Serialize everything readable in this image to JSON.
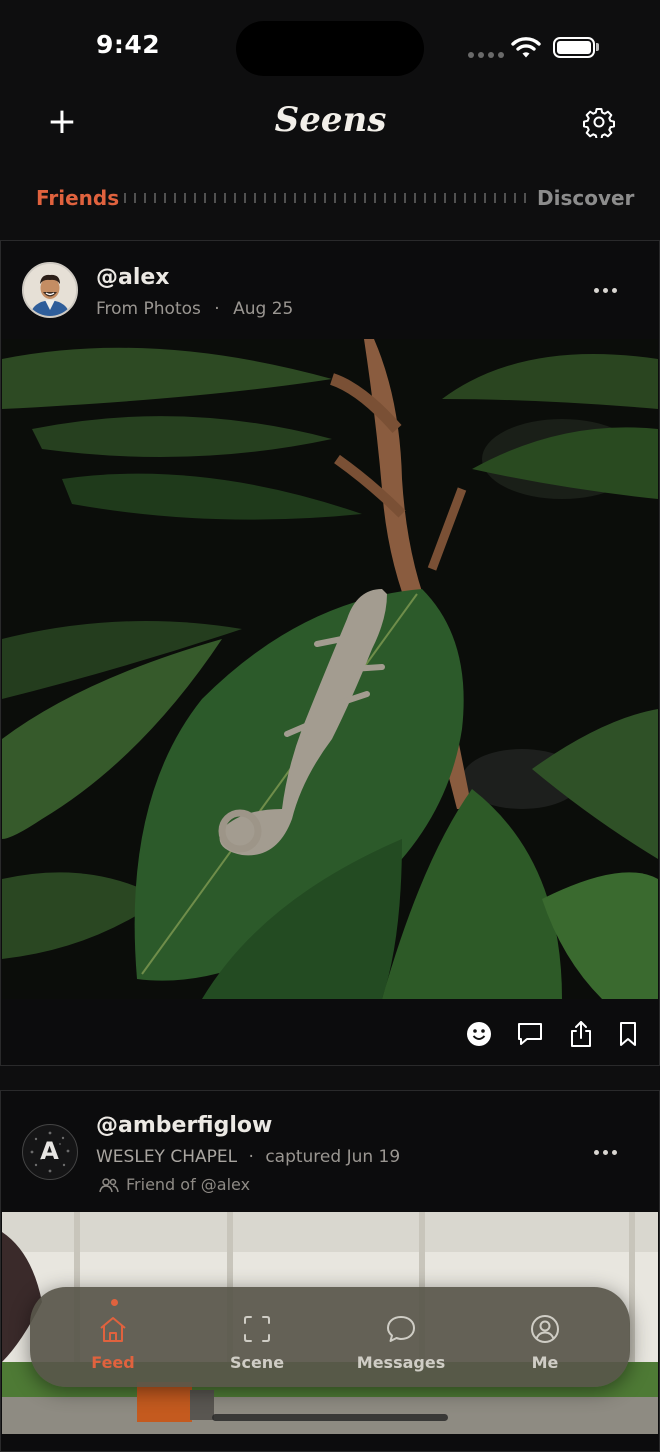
{
  "status_bar": {
    "time": "9:42"
  },
  "header": {
    "logo": "Seens",
    "add_icon": "plus-icon",
    "settings_icon": "gear-icon"
  },
  "segment": {
    "left": "Friends",
    "right": "Discover",
    "active": "Friends"
  },
  "posts": [
    {
      "username": "@alex",
      "source": "From Photos",
      "separator": "·",
      "date": "Aug 25",
      "actions": [
        "smiley-icon",
        "comment-icon",
        "share-icon",
        "bookmark-icon"
      ]
    },
    {
      "username": "@amberfiglow",
      "avatar_letter": "A",
      "location": "WESLEY CHAPEL",
      "separator": "·",
      "captured": "captured Jun 19",
      "friend_of": "Friend of @alex"
    }
  ],
  "tabbar": {
    "items": [
      {
        "label": "Feed",
        "icon": "home-icon",
        "active": true
      },
      {
        "label": "Scene",
        "icon": "scan-icon",
        "active": false
      },
      {
        "label": "Messages",
        "icon": "chat-bubble-icon",
        "active": false
      },
      {
        "label": "Me",
        "icon": "profile-icon",
        "active": false
      }
    ]
  },
  "colors": {
    "accent": "#e0623e",
    "background": "#0e0e0f",
    "tabbar": "#58564a"
  }
}
